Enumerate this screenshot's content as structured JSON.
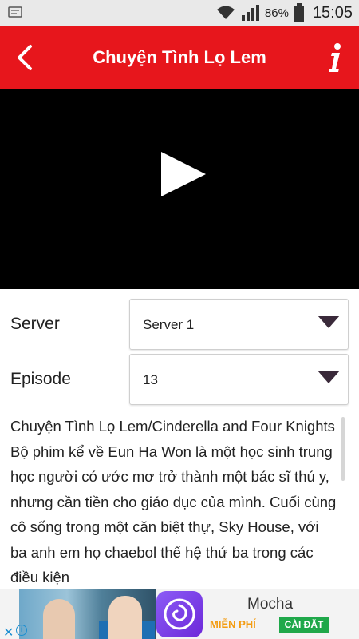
{
  "status_bar": {
    "battery": "86%",
    "time": "15:05"
  },
  "header": {
    "title": "Chuyện Tình Lọ Lem",
    "accent": "#e7161c"
  },
  "form": {
    "server_label": "Server",
    "server_value": "Server 1",
    "episode_label": "Episode",
    "episode_value": "13"
  },
  "description": "Chuyện Tình Lọ Lem/Cinderella and Four Knights Bộ phim kể về Eun Ha Won là một học sinh trung học người có ước mơ trở thành một bác sĩ thú y, nhưng cần tiền cho giáo dục của mình. Cuối cùng cô sống trong một căn biệt thự, Sky House, với ba anh em họ chaebol thế hệ thứ ba trong các điều kiện",
  "ad": {
    "app_name": "Mocha",
    "free_label": "MIỄN PHÍ",
    "install_label": "CÀI ĐẶT"
  }
}
